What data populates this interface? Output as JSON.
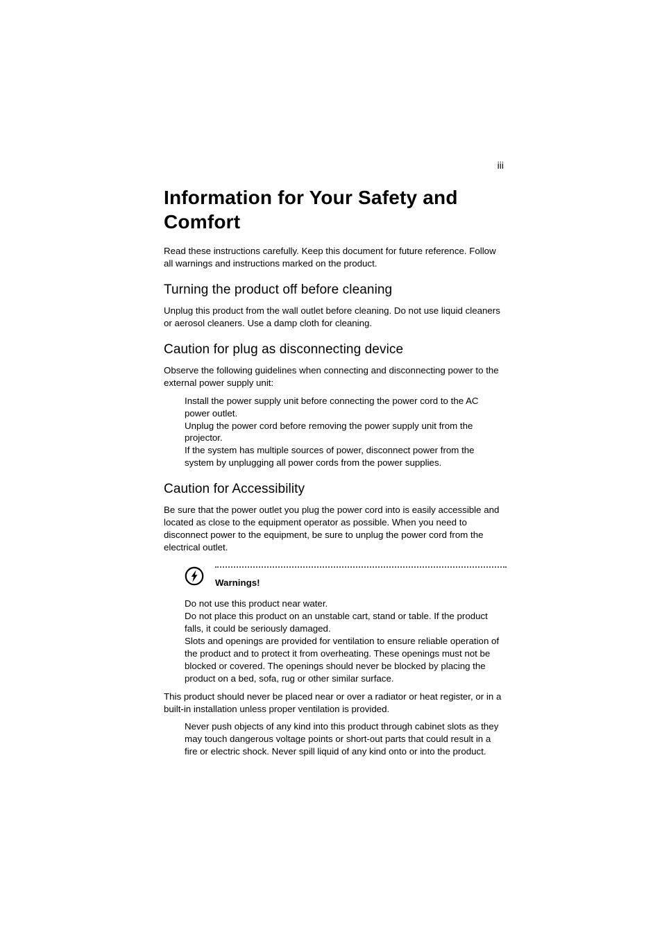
{
  "page_number": "iii",
  "title": "Information for Your Safety and Comfort",
  "intro": "Read these instructions carefully. Keep this document for future reference. Follow all warnings and instructions marked on the product.",
  "sections": {
    "cleaning": {
      "heading": "Turning the product off before cleaning",
      "body": "Unplug this product from the wall outlet before cleaning. Do not use liquid cleaners or aerosol cleaners. Use a damp cloth for cleaning."
    },
    "plug": {
      "heading": "Caution for plug as disconnecting device",
      "intro": "Observe the following guidelines when connecting and disconnecting power to the external power supply unit:",
      "items": [
        "Install the power supply unit before connecting the power cord to the AC power outlet.",
        "Unplug the power cord before removing the power supply unit from the projector.",
        "If the system has multiple sources of power, disconnect power from the system by unplugging all power cords from the power supplies."
      ]
    },
    "accessibility": {
      "heading": "Caution for Accessibility",
      "body": "Be sure that the power outlet you plug the power cord into is easily accessible and located as close to the equipment operator as possible. When you need to disconnect power to the equipment, be sure to unplug the power cord from the electrical outlet."
    }
  },
  "warnings": {
    "label": "Warnings!",
    "items1": [
      "Do not use this product near water.",
      "Do not place this product on an unstable cart, stand or table. If the product falls, it could be seriously damaged.",
      "Slots and openings are provided for ventilation to ensure reliable operation of the product and to protect it from overheating. These openings must not be blocked or covered. The openings should never be blocked by placing the product on a bed, sofa, rug or other similar surface."
    ],
    "mid": "This product should never be placed near or over a radiator or heat register, or in a built-in installation unless proper ventilation is provided.",
    "items2": [
      "Never push objects of any kind into this product through cabinet slots as they may touch dangerous voltage points or short-out parts that could result in a fire or electric shock. Never spill liquid of any kind onto or into the product."
    ]
  }
}
